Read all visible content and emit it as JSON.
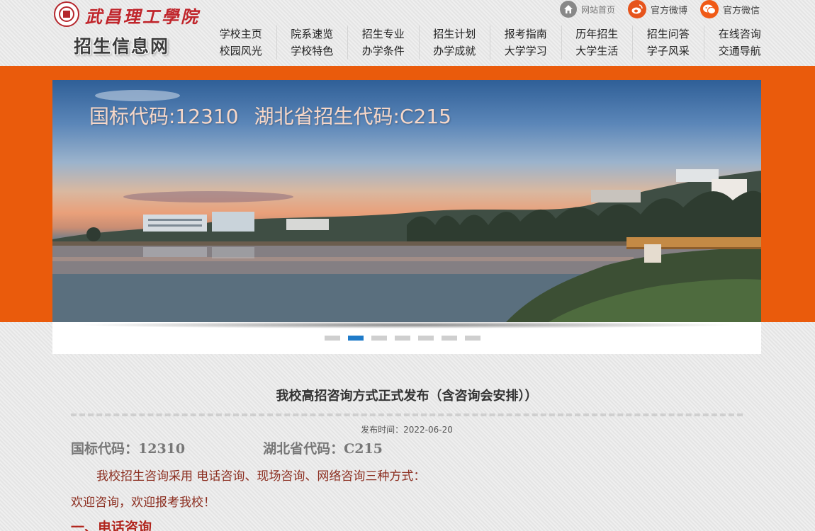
{
  "header": {
    "college_name": "武昌理工學院",
    "site_title": "招生信息网",
    "top_links": [
      {
        "label": "网站首页",
        "icon": "home-icon"
      },
      {
        "label": "官方微博",
        "icon": "weibo-icon"
      },
      {
        "label": "官方微信",
        "icon": "wechat-icon"
      }
    ],
    "nav": [
      [
        "学校主页",
        "校园风光"
      ],
      [
        "院系速览",
        "学校特色"
      ],
      [
        "招生专业",
        "办学条件"
      ],
      [
        "招生计划",
        "办学成就"
      ],
      [
        "报考指南",
        "大学学习"
      ],
      [
        "历年招生",
        "大学生活"
      ],
      [
        "招生问答",
        "学子风采"
      ],
      [
        "在线咨询",
        "交通导航"
      ]
    ]
  },
  "banner": {
    "caption_code": "国标代码:12310",
    "caption_province": "湖北省招生代码:C215",
    "slides": 7,
    "active_slide": 2
  },
  "article": {
    "title": "我校高招咨询方式正式发布（含咨询会安排））",
    "published": "发布时间：2022-06-20",
    "code_label": "国标代码：12310",
    "province_label": "湖北省代码：C215",
    "para1": "我校招生咨询采用  电话咨询、现场咨询、网络咨询三种方式：",
    "para2": "欢迎咨询，欢迎报考我校！",
    "section1": "一、电话咨询"
  },
  "colors": {
    "accent": "#ea5b0c",
    "slider_active": "#1f7bc9",
    "seal_red": "#c0252b"
  }
}
